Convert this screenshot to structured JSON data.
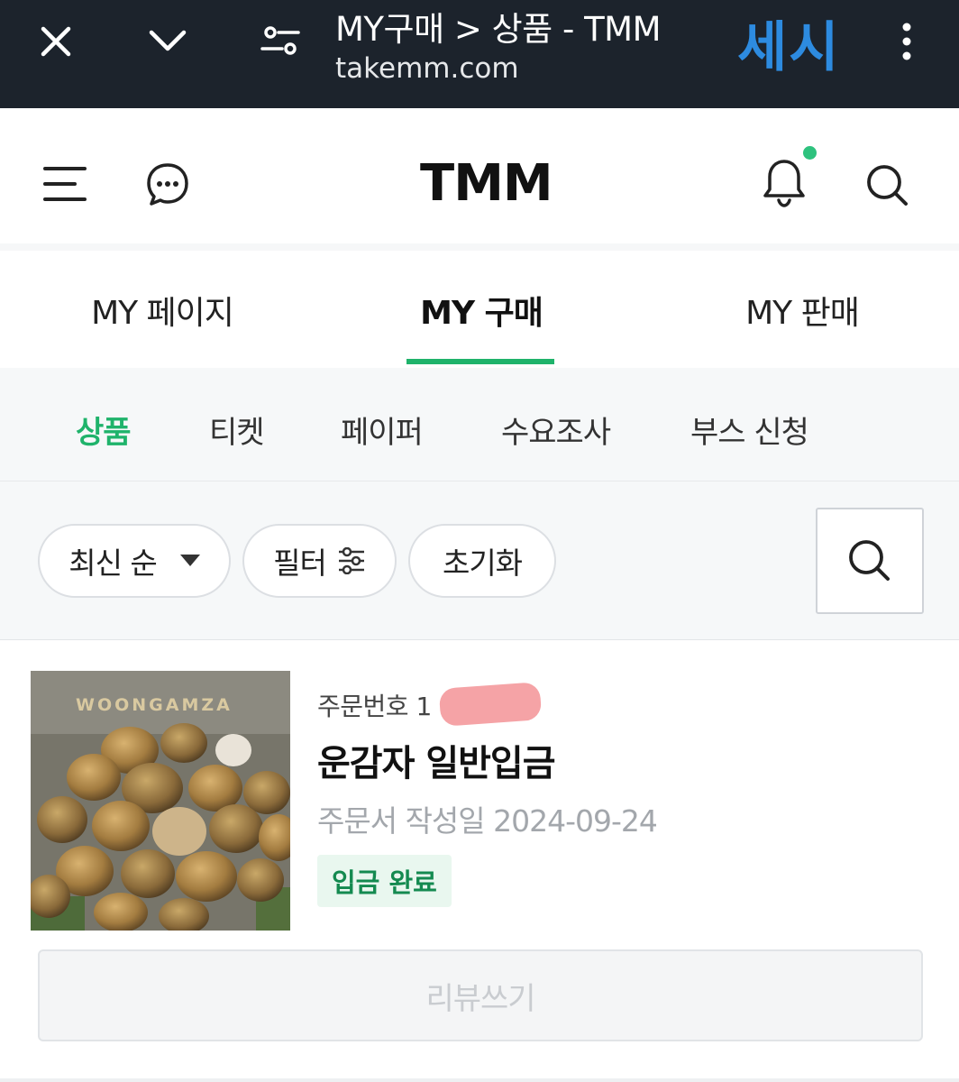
{
  "browser": {
    "title": "MY구매 > 상품 - TMM",
    "url": "takemm.com",
    "brand": "세시"
  },
  "header": {
    "logo": "TMM"
  },
  "main_tabs": [
    {
      "label": "MY 페이지"
    },
    {
      "label": "MY 구매"
    },
    {
      "label": "MY 판매"
    }
  ],
  "sub_tabs": [
    {
      "label": "상품"
    },
    {
      "label": "티켓"
    },
    {
      "label": "페이퍼"
    },
    {
      "label": "수요조사"
    },
    {
      "label": "부스 신청"
    }
  ],
  "filters": {
    "sort_label": "최신 순",
    "filter_label": "필터",
    "reset_label": "초기화"
  },
  "order": {
    "order_no_label": "주문번호 1",
    "product_name": "운감자 일반입금",
    "date_label": "주문서 작성일 2024-09-24",
    "status": "입금 완료",
    "thumbnail_text": "WOONGAMZA",
    "review_label": "리뷰쓰기"
  },
  "colors": {
    "accent": "#1fb36b",
    "topbar_bg": "#1c232c",
    "brand_blue": "#2d8be0",
    "notification_dot": "#2ec27e"
  }
}
